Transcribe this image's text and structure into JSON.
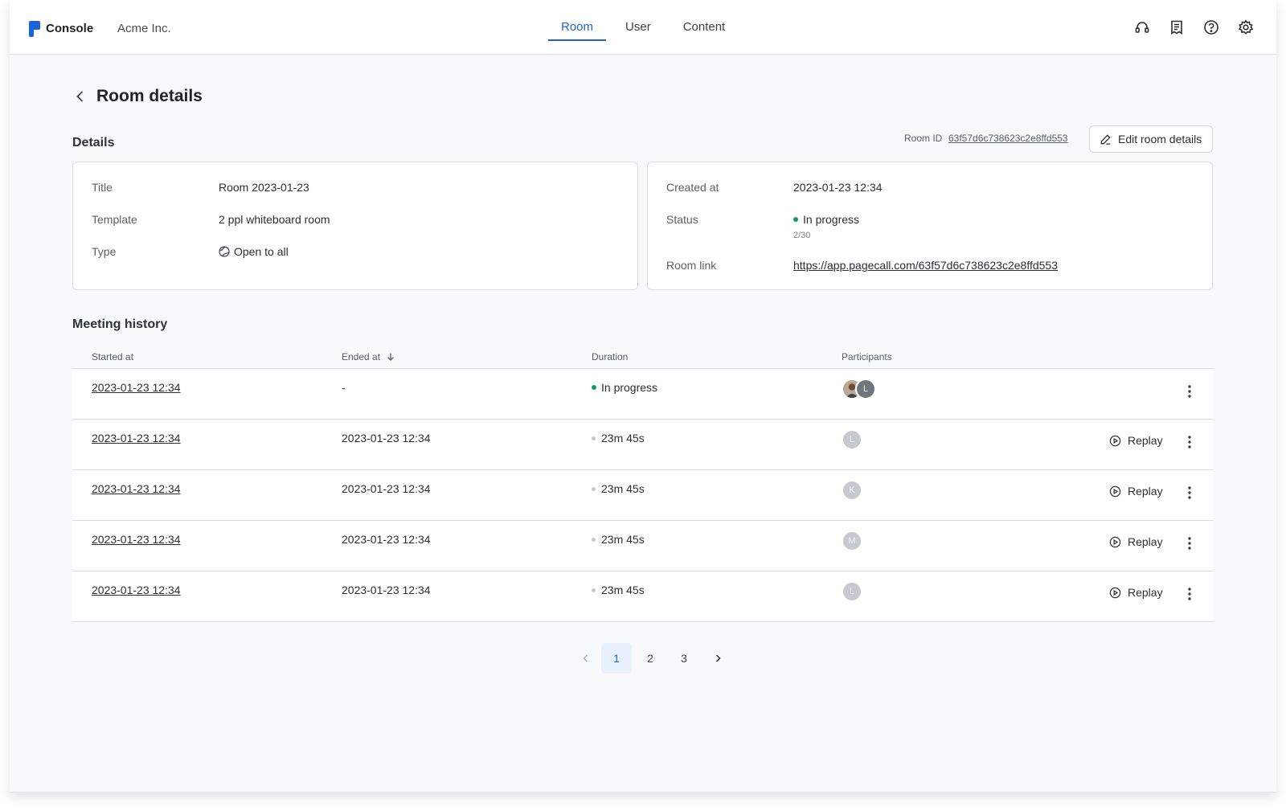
{
  "header": {
    "brand": "Console",
    "org": "Acme Inc.",
    "tabs": [
      {
        "label": "Room",
        "active": true
      },
      {
        "label": "User",
        "active": false
      },
      {
        "label": "Content",
        "active": false
      }
    ],
    "icons": [
      "headset-icon",
      "document-icon",
      "help-icon",
      "settings-icon"
    ]
  },
  "page": {
    "title": "Room details"
  },
  "details": {
    "section_title": "Details",
    "room_id_label": "Room ID",
    "room_id": "63f57d6c738623c2e8ffd553",
    "edit_label": "Edit room details",
    "left": {
      "title_label": "Title",
      "title_value": "Room 2023-01-23",
      "template_label": "Template",
      "template_value": "2 ppl whiteboard room",
      "type_label": "Type",
      "type_value": "Open to all"
    },
    "right": {
      "created_label": "Created at",
      "created_value": "2023-01-23 12:34",
      "status_label": "Status",
      "status_value": "In progress",
      "status_count": "2/30",
      "link_label": "Room link",
      "link_value": "https://app.pagecall.com/63f57d6c738623c2e8ffd553"
    }
  },
  "history": {
    "section_title": "Meeting history",
    "columns": {
      "started": "Started at",
      "ended": "Ended at",
      "duration": "Duration",
      "participants": "Participants"
    },
    "replay_label": "Replay",
    "rows": [
      {
        "started": "2023-01-23 12:34",
        "ended": "-",
        "duration": "In progress",
        "participants": [
          "photo",
          "L"
        ]
      },
      {
        "started": "2023-01-23 12:34",
        "ended": "2023-01-23 12:34",
        "duration": "23m 45s",
        "participants": [
          "L"
        ]
      },
      {
        "started": "2023-01-23 12:34",
        "ended": "2023-01-23 12:34",
        "duration": "23m 45s",
        "participants": [
          "K"
        ]
      },
      {
        "started": "2023-01-23 12:34",
        "ended": "2023-01-23 12:34",
        "duration": "23m 45s",
        "participants": [
          "M"
        ]
      },
      {
        "started": "2023-01-23 12:34",
        "ended": "2023-01-23 12:34",
        "duration": "23m 45s",
        "participants": [
          "L"
        ]
      }
    ]
  },
  "pagination": {
    "pages": [
      "1",
      "2",
      "3"
    ],
    "current": "1"
  },
  "colors": {
    "accent": "#1a63d8",
    "status_green": "#1a9a5c",
    "avatar_grey": "#c6cad0"
  }
}
